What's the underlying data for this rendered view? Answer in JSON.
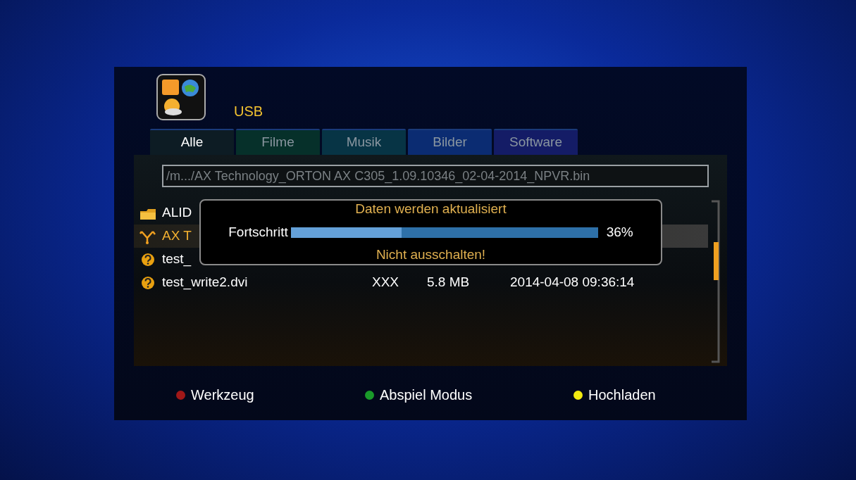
{
  "header": {
    "title": "USB"
  },
  "tabs": [
    {
      "label": "Alle",
      "selected": true,
      "color": "#0d1c24"
    },
    {
      "label": "Filme",
      "selected": false,
      "color": "#06302a"
    },
    {
      "label": "Musik",
      "selected": false,
      "color": "#073445"
    },
    {
      "label": "Bilder",
      "selected": false,
      "color": "#0b2c72"
    },
    {
      "label": "Software",
      "selected": false,
      "color": "#141c66"
    }
  ],
  "path_field": {
    "value": "/m.../AX Technology_ORTON AX C305_1.09.10346_02-04-2014_NPVR.bin"
  },
  "files": [
    {
      "kind": "folder",
      "name": "ALID",
      "selected": false
    },
    {
      "kind": "software",
      "name": "AX T",
      "selected": true
    },
    {
      "kind": "unknown",
      "name": "test_",
      "selected": false
    },
    {
      "kind": "unknown",
      "name": "test_write2.dvi",
      "selected": false,
      "type": "XXX",
      "size": "5.8 MB",
      "date": "2014-04-08 09:36:14"
    }
  ],
  "dialog": {
    "title": "Daten werden aktualisiert",
    "progress_label": "Fortschritt",
    "level": 0.36,
    "reading": "36%",
    "warning": "Nicht ausschalten!"
  },
  "footer": [
    {
      "label": "Werkzeug",
      "color": "#a01818"
    },
    {
      "label": "Abspiel Modus",
      "color": "#1a9a2a"
    },
    {
      "label": "Hochladen",
      "color": "#f2ea10"
    }
  ]
}
